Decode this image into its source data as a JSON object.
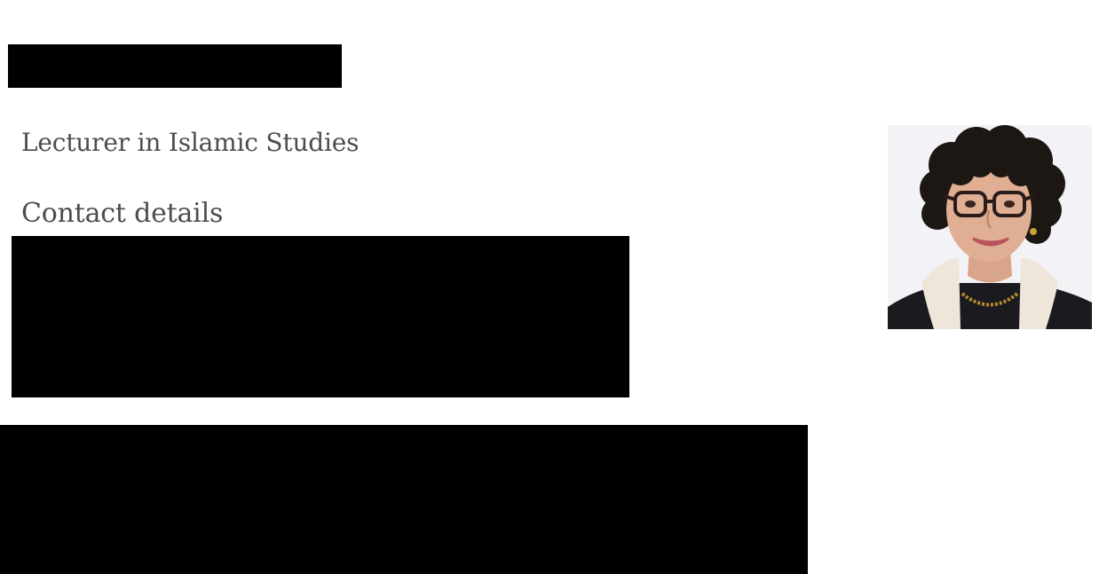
{
  "profile": {
    "job_title": "Lecturer in Islamic Studies",
    "contact_heading": "Contact details"
  },
  "photo": {
    "icon": "person-portrait",
    "background_color": "#f3f2f7"
  },
  "redactions": {
    "color": "#000000"
  }
}
